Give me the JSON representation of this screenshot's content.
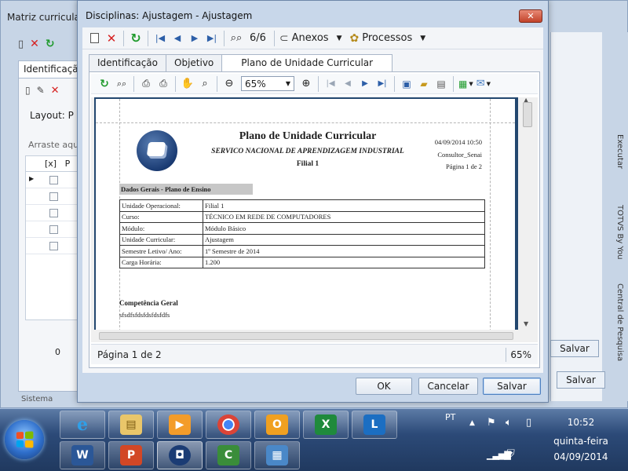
{
  "background_window": {
    "title": "Matriz curricula",
    "tab_label": "Identificaçã",
    "layout_label": "Layout:",
    "layout_value": "P",
    "drag_hint": "Arraste aqui",
    "grid_header": "[x]",
    "grid_header2": "P",
    "row_count": "0",
    "save_label_1": "Salvar",
    "save_label_2": "Salvar",
    "side_labels": [
      "Executar",
      "TOTVS By You",
      "Central de Pesquisa"
    ],
    "bottom_label": "Sistema"
  },
  "dialog": {
    "title": "Disciplinas: Ajustagem - Ajustagem",
    "close_label": "✕",
    "toolbar": {
      "record_position": "6/6",
      "attachments_label": "Anexos",
      "processes_label": "Processos"
    },
    "tabs": [
      {
        "label": "Identificação",
        "active": false
      },
      {
        "label": "Objetivo",
        "active": false
      },
      {
        "label": "Plano de Unidade Curricular",
        "active": true
      }
    ],
    "viewer_toolbar": {
      "zoom_value": "65%"
    },
    "report": {
      "title": "Plano de Unidade Curricular",
      "organization": "SERVICO NACIONAL DE APRENDIZAGEM INDUSTRIAL",
      "branch": "Filial 1",
      "date_time": "04/09/2014 10:50",
      "user": "Consultor_Senai",
      "page_info": "Página 1 de 2",
      "section_header": "Dados Gerais - Plano de Ensino",
      "rows": [
        {
          "label": "Unidade Operacional:",
          "value": "Filial 1"
        },
        {
          "label": "Curso:",
          "value": "TÉCNICO EM REDE DE COMPUTADORES"
        },
        {
          "label": "Módulo:",
          "value": "Módulo Básico"
        },
        {
          "label": "Unidade Curricular:",
          "value": "Ajustagem"
        },
        {
          "label": "Semestre Letivo/ Ano:",
          "value": "1º Semestre de 2014"
        },
        {
          "label": "Carga Horária:",
          "value": "1.200"
        }
      ],
      "competence_title": "Competência Geral",
      "competence_text": "sfsdfsfdsfdsfdsfdfs"
    },
    "status": {
      "page_label": "Página 1 de 2",
      "zoom_label": "65%"
    },
    "buttons": {
      "ok": "OK",
      "cancel": "Cancelar",
      "save": "Salvar"
    }
  },
  "taskbar": {
    "language": "PT",
    "time": "10:52",
    "weekday": "quinta-feira",
    "date": "04/09/2014",
    "apps": [
      {
        "name": "internet-explorer",
        "glyph": "e"
      },
      {
        "name": "file-explorer",
        "glyph": "▤"
      },
      {
        "name": "media-player",
        "glyph": "▶"
      },
      {
        "name": "chrome",
        "glyph": "◉"
      },
      {
        "name": "outlook",
        "glyph": "O"
      },
      {
        "name": "excel",
        "glyph": "X"
      },
      {
        "name": "lync",
        "glyph": "L"
      },
      {
        "name": "word",
        "glyph": "W"
      },
      {
        "name": "powerpoint",
        "glyph": "P"
      },
      {
        "name": "totvs",
        "glyph": "◘"
      },
      {
        "name": "camtasia",
        "glyph": "C"
      },
      {
        "name": "control-panel",
        "glyph": "▦"
      }
    ]
  },
  "colors": {
    "accent": "#2f6fcb",
    "close_red": "#c2432a",
    "section_gray": "#c7c7c7"
  }
}
